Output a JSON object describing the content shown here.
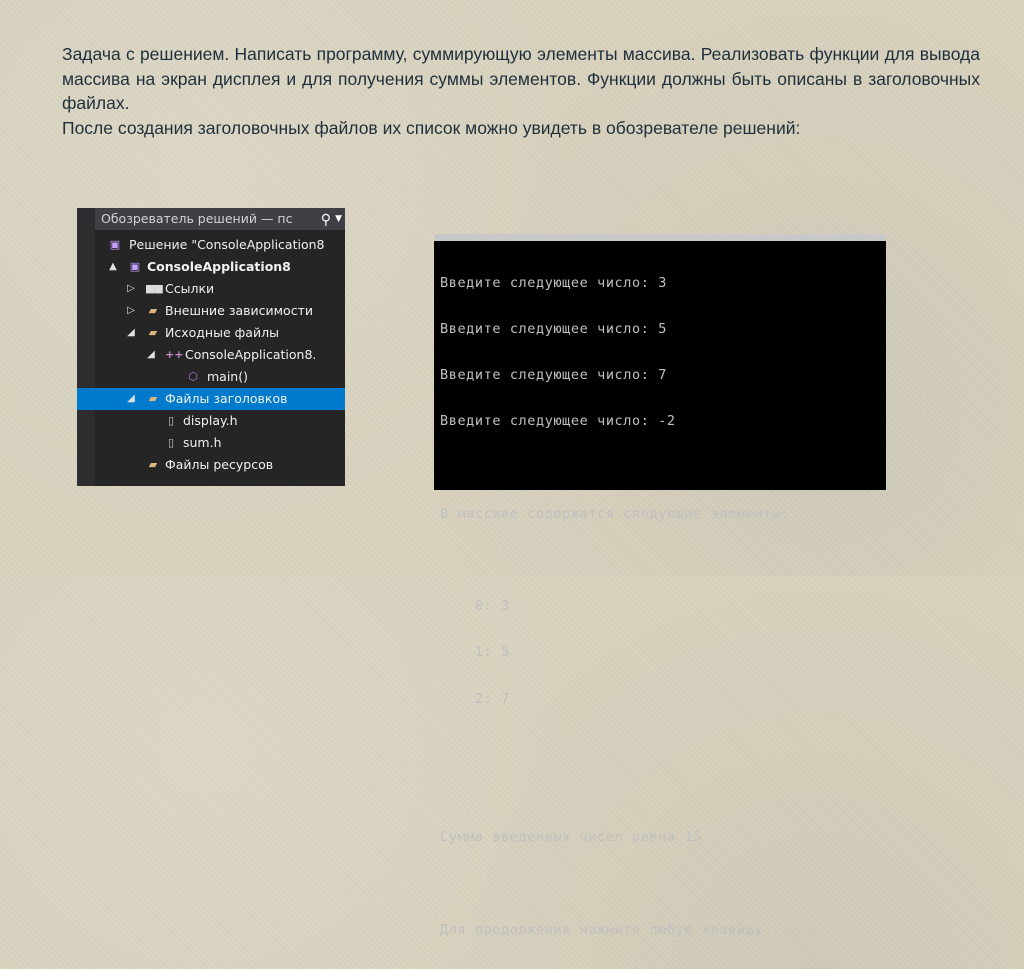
{
  "slide": {
    "paragraph1": "Задача с решением. Написать программу, суммирующую элементы массива. Реализовать функции для вывода массива на экран дисплея и для получения суммы элементов. Функции должны быть описаны в заголовочных файлах.",
    "paragraph2": "После создания заголовочных файлов их список можно увидеть в обозревателе решений:"
  },
  "explorer": {
    "title": "Обозреватель решений — пс",
    "search_icon": "search-icon",
    "items": [
      {
        "label": "Решение \"ConsoleApplication8",
        "arrow": "",
        "icon": "solution-icon",
        "depth": 0
      },
      {
        "label": "ConsoleApplication8",
        "arrow": "▲",
        "icon": "project-icon",
        "depth": 0
      },
      {
        "label": "Ссылки",
        "arrow": "▷",
        "icon": "references-icon",
        "depth": 1
      },
      {
        "label": "Внешние зависимости",
        "arrow": "▷",
        "icon": "folder-icon",
        "depth": 1
      },
      {
        "label": "Исходные файлы",
        "arrow": "◢",
        "icon": "folder-icon",
        "depth": 1
      },
      {
        "label": "ConsoleApplication8.",
        "arrow": "◢",
        "icon": "cpp-file-icon",
        "depth": 2
      },
      {
        "label": "main()",
        "arrow": "",
        "icon": "function-icon",
        "depth": 3
      },
      {
        "label": "Файлы заголовков",
        "arrow": "◢",
        "icon": "folder-icon",
        "depth": 1
      },
      {
        "label": "display.h",
        "arrow": "",
        "icon": "header-file-icon",
        "depth": 2
      },
      {
        "label": "sum.h",
        "arrow": "",
        "icon": "header-file-icon",
        "depth": 2
      },
      {
        "label": "Файлы ресурсов",
        "arrow": "",
        "icon": "folder-icon",
        "depth": 1
      }
    ],
    "selected_label": "Файлы заголовков"
  },
  "console": {
    "lines": [
      "Введите следующее число: 3",
      "Введите следующее число: 5",
      "Введите следующее число: 7",
      "Введите следующее число: -2",
      "",
      "В массиве содержатся следующие элементы:",
      "",
      "    0: 3",
      "    1: 5",
      "    2: 7",
      "",
      "",
      "Сумма введенных чисел равна 15",
      "",
      "Для продолжения нажмите любую клавишу . . ."
    ]
  },
  "colors": {
    "selection": "#007acc",
    "explorer_bg": "#252526",
    "console_bg": "#000000",
    "slide_text": "#1f2f3b"
  }
}
